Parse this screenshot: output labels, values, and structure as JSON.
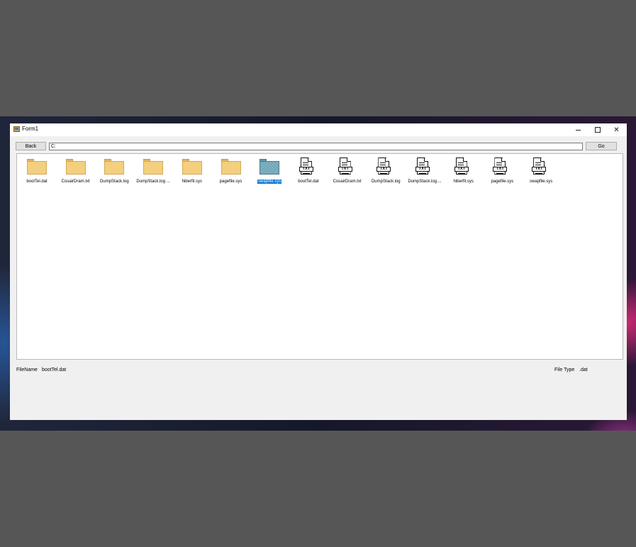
{
  "window": {
    "title": "Form1",
    "minimize_glyph": "—",
    "maximize_glyph": "☐",
    "close_glyph": "✕"
  },
  "toolbar": {
    "back_label": "Back",
    "path_value": "C:",
    "go_label": "Go"
  },
  "files": [
    {
      "name": "bootTel.dat",
      "kind": "folder",
      "selected": false
    },
    {
      "name": "CosairDram.txt",
      "kind": "folder",
      "selected": false
    },
    {
      "name": "DumpStack.log",
      "kind": "folder",
      "selected": false
    },
    {
      "name": "DumpStack.log ...",
      "kind": "folder",
      "selected": false
    },
    {
      "name": "hiberfil.sys",
      "kind": "folder",
      "selected": false
    },
    {
      "name": "pagefile.sys",
      "kind": "folder",
      "selected": false
    },
    {
      "name": "swapfile.sys",
      "kind": "folder",
      "selected": true
    },
    {
      "name": "bootTel.dat",
      "kind": "txt",
      "selected": false
    },
    {
      "name": "CosairDram.txt",
      "kind": "txt",
      "selected": false
    },
    {
      "name": "DumpStack.log",
      "kind": "txt",
      "selected": false
    },
    {
      "name": "DumpStack.log....",
      "kind": "txt",
      "selected": false
    },
    {
      "name": "hiberfil.sys",
      "kind": "txt",
      "selected": false
    },
    {
      "name": "pagefile.sys",
      "kind": "txt",
      "selected": false
    },
    {
      "name": "swapfile.sys",
      "kind": "txt",
      "selected": false
    }
  ],
  "icon_badge": "TXT",
  "status": {
    "filename_caption": "FileName",
    "filename_value": "bootTel.dat",
    "filetype_caption": "File Type",
    "filetype_value": ".dat"
  },
  "colors": {
    "selection": "#0078d7",
    "folder": "#f3cf7e",
    "selected_folder": "#6fa6b8",
    "desktop_backdrop": "#565656"
  }
}
